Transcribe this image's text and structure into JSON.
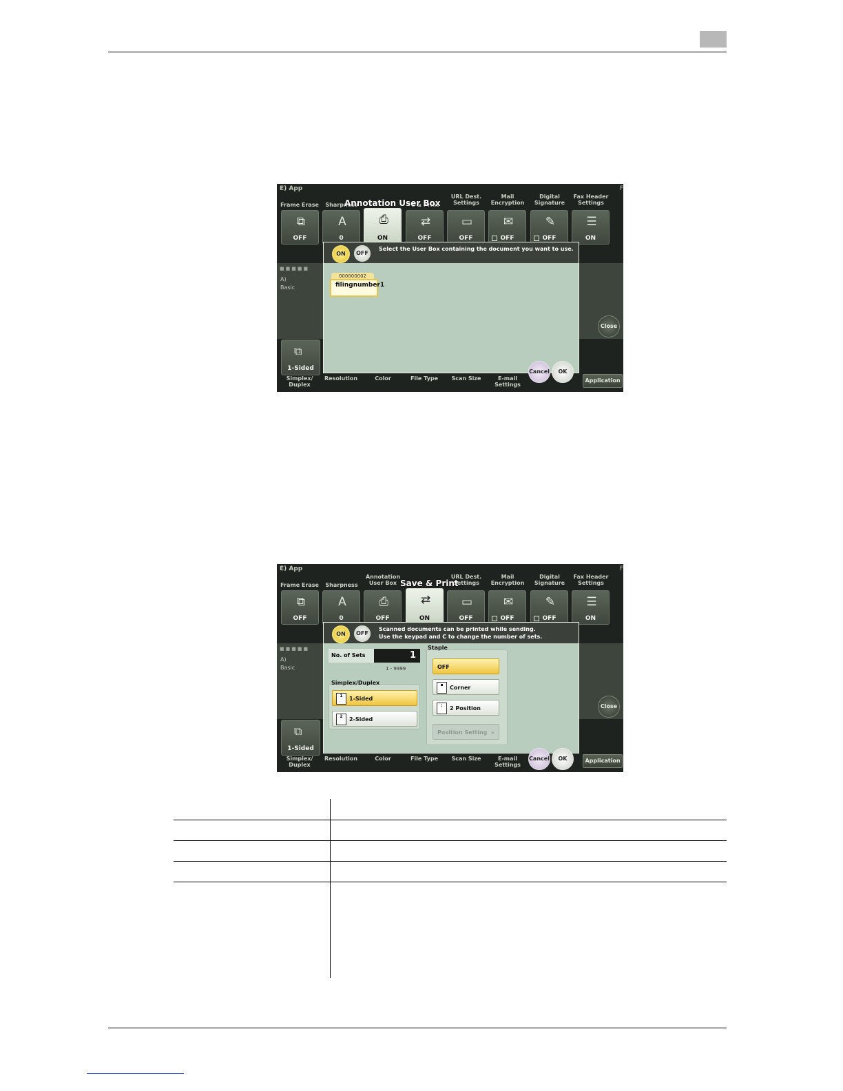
{
  "screen1": {
    "header_left": "E)  App",
    "header_right": "F",
    "dialog_title": "Annotation User Box",
    "functions": [
      {
        "label": "Frame Erase",
        "value": "OFF",
        "icon": "frame-erase-icon"
      },
      {
        "label": "Sharpness",
        "value": "0",
        "icon": "sharpness-icon"
      },
      {
        "label": "",
        "value": "ON",
        "icon": "printer-icon"
      },
      {
        "label": "e & Print",
        "value": "OFF",
        "icon": "save-print-icon"
      },
      {
        "label": "URL Dest.\nSettings",
        "value": "OFF",
        "icon": "url-dest-icon"
      },
      {
        "label": "Mail\nEncryption",
        "value": "OFF",
        "icon": "mail-encryption-icon"
      },
      {
        "label": "Digital\nSignature",
        "value": "OFF",
        "icon": "digital-signature-icon"
      },
      {
        "label": "Fax Header\nSettings",
        "value": "ON",
        "icon": "fax-header-icon"
      }
    ],
    "toggle_on": "ON",
    "toggle_off": "OFF",
    "message": "Select the User Box containing the document you want to use.",
    "folder_number": "000000002",
    "folder_name": "filingnumber1",
    "strip_a": "A)",
    "strip_basic": "Basic",
    "close_label": "Close",
    "bottom_btn_value": "1-Sided",
    "bottom_labels": [
      "Simplex/\nDuplex",
      "Resolution",
      "Color",
      "File Type",
      "Scan Size",
      "E-mail\nSettings"
    ],
    "cancel_label": "Cancel",
    "ok_label": "OK",
    "application_label": "Application"
  },
  "screen2": {
    "header_left": "E)  App",
    "header_right": "F",
    "dialog_title": "Save & Print",
    "functions": [
      {
        "label": "Frame Erase",
        "value": "OFF",
        "icon": "frame-erase-icon"
      },
      {
        "label": "Sharpness",
        "value": "0",
        "icon": "sharpness-icon"
      },
      {
        "label": "Annotation\nUser Box",
        "value": "OFF",
        "icon": "printer-icon"
      },
      {
        "label": "",
        "value": "ON",
        "icon": "save-print-icon"
      },
      {
        "label": "URL Dest.\nSettings",
        "value": "OFF",
        "icon": "url-dest-icon"
      },
      {
        "label": "Mail\nEncryption",
        "value": "OFF",
        "icon": "mail-encryption-icon"
      },
      {
        "label": "Digital\nSignature",
        "value": "OFF",
        "icon": "digital-signature-icon"
      },
      {
        "label": "Fax Header\nSettings",
        "value": "ON",
        "icon": "fax-header-icon"
      }
    ],
    "toggle_on": "ON",
    "toggle_off": "OFF",
    "message_line1": "Scanned documents can be printed while sending.",
    "message_line2": "Use the keypad and C to change the number of sets.",
    "sets_label": "No. of Sets",
    "sets_value": "1",
    "sets_range": "1 - 9999",
    "simplex_title": "Simplex/Duplex",
    "simplex_options": [
      "1-Sided",
      "2-Sided"
    ],
    "staple_title": "Staple",
    "staple_options": [
      "OFF",
      "Corner",
      "2 Position"
    ],
    "position_setting": "Position Setting",
    "strip_a": "A)",
    "strip_basic": "Basic",
    "close_label": "Close",
    "bottom_btn_value": "1-Sided",
    "bottom_labels": [
      "Simplex/\nDuplex",
      "Resolution",
      "Color",
      "File Type",
      "Scan Size",
      "E-mail\nSettings"
    ],
    "cancel_label": "Cancel",
    "ok_label": "OK",
    "application_label": "Application"
  }
}
